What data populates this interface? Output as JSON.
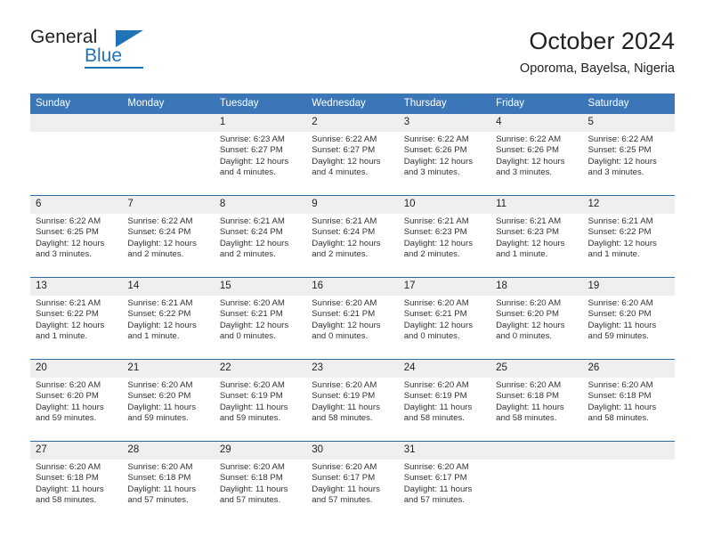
{
  "brand": {
    "name_part1": "General",
    "name_part2": "Blue",
    "accent_color": "#2173b8"
  },
  "header": {
    "title": "October 2024",
    "location": "Oporoma, Bayelsa, Nigeria"
  },
  "theme": {
    "header_blue": "#3a76b8",
    "separator_blue": "#2e6ca8",
    "date_band_gray": "#efefef"
  },
  "weekdays": [
    "Sunday",
    "Monday",
    "Tuesday",
    "Wednesday",
    "Thursday",
    "Friday",
    "Saturday"
  ],
  "weeks": [
    [
      {
        "date": "",
        "lines": []
      },
      {
        "date": "",
        "lines": []
      },
      {
        "date": "1",
        "lines": [
          "Sunrise: 6:23 AM",
          "Sunset: 6:27 PM",
          "Daylight: 12 hours",
          "and 4 minutes."
        ]
      },
      {
        "date": "2",
        "lines": [
          "Sunrise: 6:22 AM",
          "Sunset: 6:27 PM",
          "Daylight: 12 hours",
          "and 4 minutes."
        ]
      },
      {
        "date": "3",
        "lines": [
          "Sunrise: 6:22 AM",
          "Sunset: 6:26 PM",
          "Daylight: 12 hours",
          "and 3 minutes."
        ]
      },
      {
        "date": "4",
        "lines": [
          "Sunrise: 6:22 AM",
          "Sunset: 6:26 PM",
          "Daylight: 12 hours",
          "and 3 minutes."
        ]
      },
      {
        "date": "5",
        "lines": [
          "Sunrise: 6:22 AM",
          "Sunset: 6:25 PM",
          "Daylight: 12 hours",
          "and 3 minutes."
        ]
      }
    ],
    [
      {
        "date": "6",
        "lines": [
          "Sunrise: 6:22 AM",
          "Sunset: 6:25 PM",
          "Daylight: 12 hours",
          "and 3 minutes."
        ]
      },
      {
        "date": "7",
        "lines": [
          "Sunrise: 6:22 AM",
          "Sunset: 6:24 PM",
          "Daylight: 12 hours",
          "and 2 minutes."
        ]
      },
      {
        "date": "8",
        "lines": [
          "Sunrise: 6:21 AM",
          "Sunset: 6:24 PM",
          "Daylight: 12 hours",
          "and 2 minutes."
        ]
      },
      {
        "date": "9",
        "lines": [
          "Sunrise: 6:21 AM",
          "Sunset: 6:24 PM",
          "Daylight: 12 hours",
          "and 2 minutes."
        ]
      },
      {
        "date": "10",
        "lines": [
          "Sunrise: 6:21 AM",
          "Sunset: 6:23 PM",
          "Daylight: 12 hours",
          "and 2 minutes."
        ]
      },
      {
        "date": "11",
        "lines": [
          "Sunrise: 6:21 AM",
          "Sunset: 6:23 PM",
          "Daylight: 12 hours",
          "and 1 minute."
        ]
      },
      {
        "date": "12",
        "lines": [
          "Sunrise: 6:21 AM",
          "Sunset: 6:22 PM",
          "Daylight: 12 hours",
          "and 1 minute."
        ]
      }
    ],
    [
      {
        "date": "13",
        "lines": [
          "Sunrise: 6:21 AM",
          "Sunset: 6:22 PM",
          "Daylight: 12 hours",
          "and 1 minute."
        ]
      },
      {
        "date": "14",
        "lines": [
          "Sunrise: 6:21 AM",
          "Sunset: 6:22 PM",
          "Daylight: 12 hours",
          "and 1 minute."
        ]
      },
      {
        "date": "15",
        "lines": [
          "Sunrise: 6:20 AM",
          "Sunset: 6:21 PM",
          "Daylight: 12 hours",
          "and 0 minutes."
        ]
      },
      {
        "date": "16",
        "lines": [
          "Sunrise: 6:20 AM",
          "Sunset: 6:21 PM",
          "Daylight: 12 hours",
          "and 0 minutes."
        ]
      },
      {
        "date": "17",
        "lines": [
          "Sunrise: 6:20 AM",
          "Sunset: 6:21 PM",
          "Daylight: 12 hours",
          "and 0 minutes."
        ]
      },
      {
        "date": "18",
        "lines": [
          "Sunrise: 6:20 AM",
          "Sunset: 6:20 PM",
          "Daylight: 12 hours",
          "and 0 minutes."
        ]
      },
      {
        "date": "19",
        "lines": [
          "Sunrise: 6:20 AM",
          "Sunset: 6:20 PM",
          "Daylight: 11 hours",
          "and 59 minutes."
        ]
      }
    ],
    [
      {
        "date": "20",
        "lines": [
          "Sunrise: 6:20 AM",
          "Sunset: 6:20 PM",
          "Daylight: 11 hours",
          "and 59 minutes."
        ]
      },
      {
        "date": "21",
        "lines": [
          "Sunrise: 6:20 AM",
          "Sunset: 6:20 PM",
          "Daylight: 11 hours",
          "and 59 minutes."
        ]
      },
      {
        "date": "22",
        "lines": [
          "Sunrise: 6:20 AM",
          "Sunset: 6:19 PM",
          "Daylight: 11 hours",
          "and 59 minutes."
        ]
      },
      {
        "date": "23",
        "lines": [
          "Sunrise: 6:20 AM",
          "Sunset: 6:19 PM",
          "Daylight: 11 hours",
          "and 58 minutes."
        ]
      },
      {
        "date": "24",
        "lines": [
          "Sunrise: 6:20 AM",
          "Sunset: 6:19 PM",
          "Daylight: 11 hours",
          "and 58 minutes."
        ]
      },
      {
        "date": "25",
        "lines": [
          "Sunrise: 6:20 AM",
          "Sunset: 6:18 PM",
          "Daylight: 11 hours",
          "and 58 minutes."
        ]
      },
      {
        "date": "26",
        "lines": [
          "Sunrise: 6:20 AM",
          "Sunset: 6:18 PM",
          "Daylight: 11 hours",
          "and 58 minutes."
        ]
      }
    ],
    [
      {
        "date": "27",
        "lines": [
          "Sunrise: 6:20 AM",
          "Sunset: 6:18 PM",
          "Daylight: 11 hours",
          "and 58 minutes."
        ]
      },
      {
        "date": "28",
        "lines": [
          "Sunrise: 6:20 AM",
          "Sunset: 6:18 PM",
          "Daylight: 11 hours",
          "and 57 minutes."
        ]
      },
      {
        "date": "29",
        "lines": [
          "Sunrise: 6:20 AM",
          "Sunset: 6:18 PM",
          "Daylight: 11 hours",
          "and 57 minutes."
        ]
      },
      {
        "date": "30",
        "lines": [
          "Sunrise: 6:20 AM",
          "Sunset: 6:17 PM",
          "Daylight: 11 hours",
          "and 57 minutes."
        ]
      },
      {
        "date": "31",
        "lines": [
          "Sunrise: 6:20 AM",
          "Sunset: 6:17 PM",
          "Daylight: 11 hours",
          "and 57 minutes."
        ]
      },
      {
        "date": "",
        "lines": []
      },
      {
        "date": "",
        "lines": []
      }
    ]
  ]
}
